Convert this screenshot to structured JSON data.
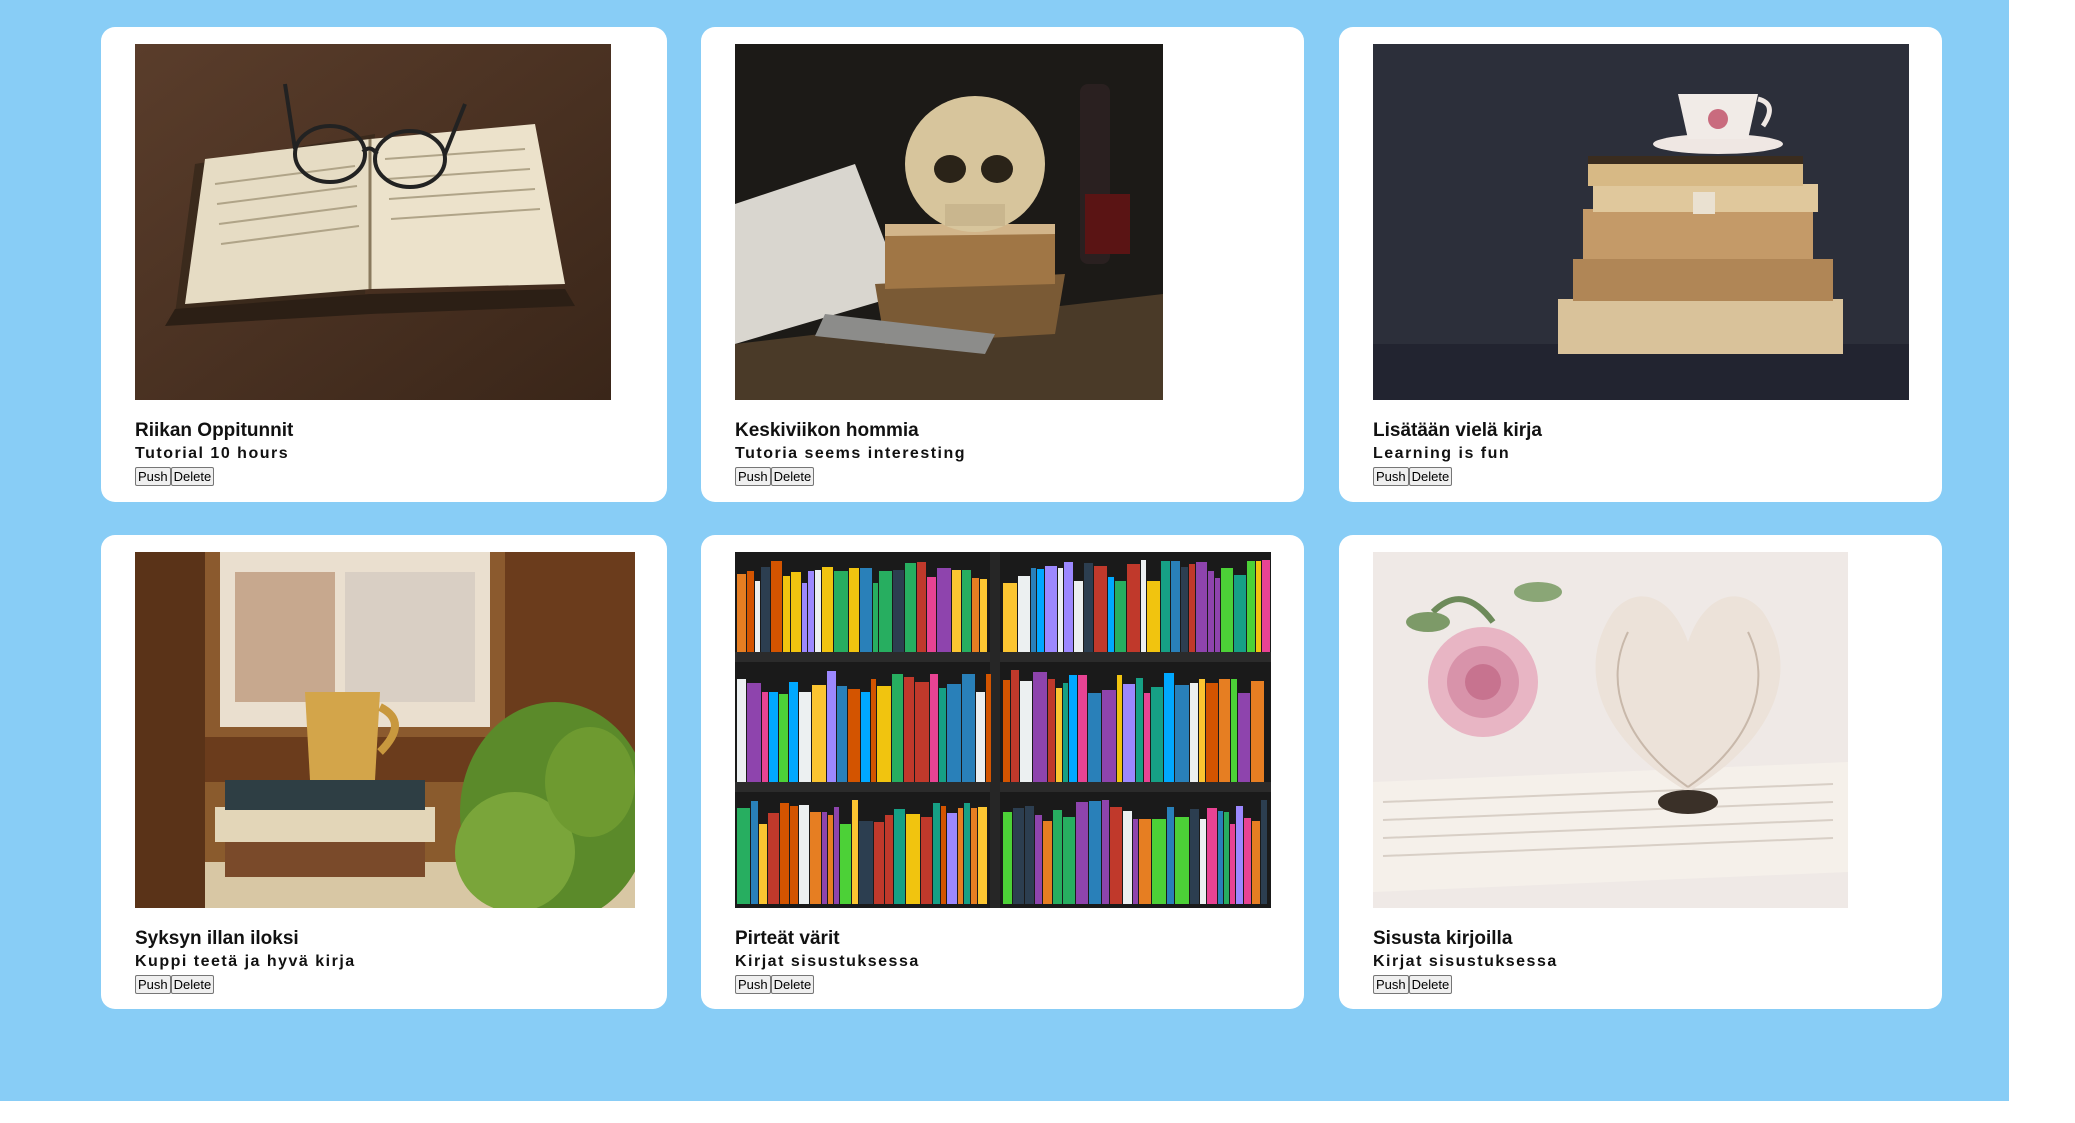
{
  "cards": [
    {
      "title": "Riikan Oppitunnit",
      "subtitle": "Tutorial 10 hours",
      "push_label": "Push",
      "delete_label": "Delete",
      "image": "open-book-with-glasses"
    },
    {
      "title": "Keskiviikon hommia",
      "subtitle": "Tutoria seems interesting",
      "push_label": "Push",
      "delete_label": "Delete",
      "image": "skull-on-books"
    },
    {
      "title": "Lisätään vielä kirja",
      "subtitle": "Learning is fun",
      "push_label": "Push",
      "delete_label": "Delete",
      "image": "teacup-on-book-stack"
    },
    {
      "title": "Syksyn illan iloksi",
      "subtitle": "Kuppi teetä ja hyvä kirja",
      "push_label": "Push",
      "delete_label": "Delete",
      "image": "mug-books-window-plant"
    },
    {
      "title": "Pirteät värit",
      "subtitle": "Kirjat sisustuksessa",
      "push_label": "Push",
      "delete_label": "Delete",
      "image": "colorful-bookshelf"
    },
    {
      "title": "Sisusta kirjoilla",
      "subtitle": "Kirjat sisustuksessa",
      "push_label": "Push",
      "delete_label": "Delete",
      "image": "rose-and-heart-book"
    }
  ],
  "colors": {
    "background": "#88cdf6",
    "card": "#ffffff"
  }
}
